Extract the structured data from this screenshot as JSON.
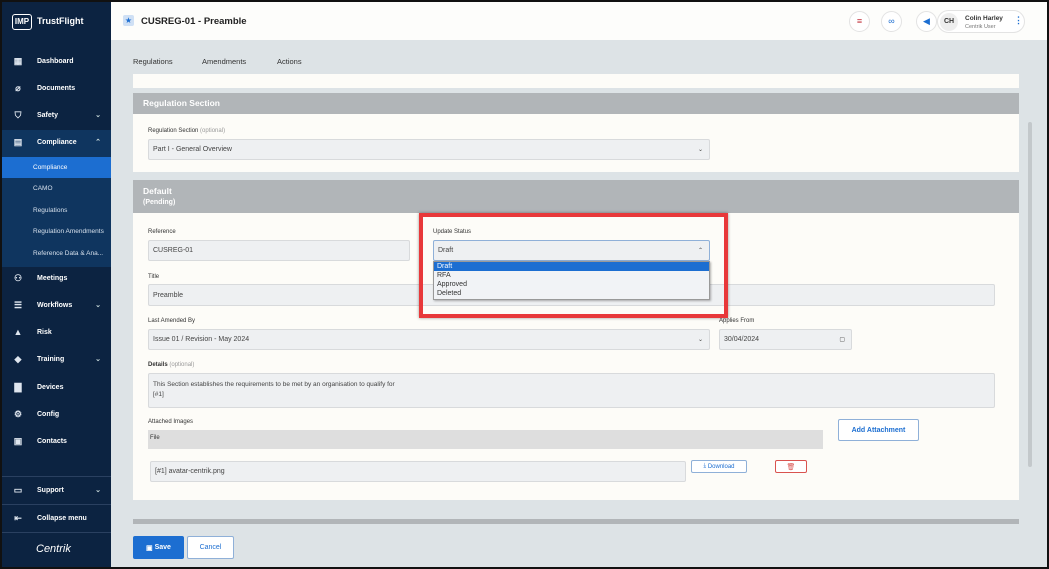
{
  "sidebar": {
    "brand_badge": "IMP",
    "brand": "TrustFlight",
    "items": [
      {
        "label": "Dashboard"
      },
      {
        "label": "Documents"
      },
      {
        "label": "Safety"
      },
      {
        "label": "Compliance"
      },
      {
        "label": "Meetings"
      },
      {
        "label": "Workflows"
      },
      {
        "label": "Risk"
      },
      {
        "label": "Training"
      },
      {
        "label": "Devices"
      },
      {
        "label": "Config"
      },
      {
        "label": "Contacts"
      }
    ],
    "compliance_sub": [
      {
        "label": "Compliance"
      },
      {
        "label": "CAMO"
      },
      {
        "label": "Regulations"
      },
      {
        "label": "Regulation Amendments"
      },
      {
        "label": "Reference Data & Ana..."
      }
    ],
    "support": "Support",
    "collapse": "Collapse menu",
    "footer_logo": "Centrik"
  },
  "header": {
    "title": "CUSREG-01 - Preamble",
    "user_initials": "CH",
    "user_name": "Colin Harley",
    "user_role": "Centrik User"
  },
  "tabs": [
    "Regulations",
    "Amendments",
    "Actions"
  ],
  "regulation_section": {
    "heading": "Regulation Section",
    "label": "Regulation Section",
    "optional": "(optional)",
    "value": "Part I - General Overview"
  },
  "default_section": {
    "heading": "Default",
    "status": "(Pending)",
    "reference": {
      "label": "Reference",
      "value": "CUSREG-01"
    },
    "update_status": {
      "label": "Update Status",
      "value": "Draft",
      "options": [
        "Draft",
        "RFA",
        "Approved",
        "Deleted"
      ],
      "highlighted": "Draft"
    },
    "title": {
      "label": "Title",
      "value": "Preamble"
    },
    "last_amended_by": {
      "label": "Last Amended By",
      "value": "Issue 01 / Revision - May 2024"
    },
    "applies_from": {
      "label": "Applies From",
      "value": "30/04/2024"
    },
    "details": {
      "label": "Details",
      "optional": "(optional)",
      "line1": "This Section establishes the requirements to be met by an organisation to qualify for",
      "line2": "[#1]"
    },
    "attached_images": {
      "label": "Attached Images",
      "column": "File",
      "add_button": "Add Attachment",
      "file": "[#1] avatar-centrik.png",
      "download": "Download"
    }
  },
  "footer": {
    "save": "Save",
    "cancel": "Cancel"
  },
  "colors": {
    "sidebar": "#0c2341",
    "accent": "#1c6ed1",
    "highlight_box": "#e8383a"
  }
}
